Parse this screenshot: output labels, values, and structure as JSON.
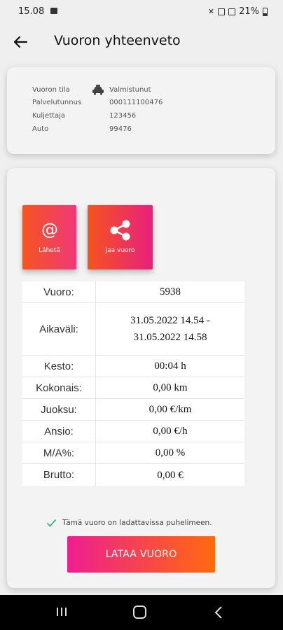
{
  "status_bar": {
    "time": "15.08",
    "battery_pct": "21%"
  },
  "app_bar": {
    "title": "Vuoron yhteenveto"
  },
  "summary": {
    "rows": [
      {
        "label": "Vuoron tila",
        "value": "Valmistunut"
      },
      {
        "label": "Palvelutunnus",
        "value": "000111100476"
      },
      {
        "label": "Kuljettaja",
        "value": "123456"
      },
      {
        "label": "Auto",
        "value": "99476"
      }
    ]
  },
  "actions": {
    "send_label": "Lähetä",
    "share_label": "Jaa vuoro"
  },
  "details": {
    "rows": [
      {
        "label": "Vuoro:",
        "value": "5938"
      },
      {
        "label": "Aikaväli:",
        "value": "31.05.2022 14.54 -",
        "value2": "31.05.2022 14.58"
      },
      {
        "label": "Kesto:",
        "value": "00:04 h"
      },
      {
        "label": "Kokonais:",
        "value": "0,00 km"
      },
      {
        "label": "Juoksu:",
        "value": "0,00 €/km"
      },
      {
        "label": "Ansio:",
        "value": "0,00 €/h"
      },
      {
        "label": "M/A%:",
        "value": "0,00 %"
      },
      {
        "label": "Brutto:",
        "value": "0,00 €"
      }
    ]
  },
  "download": {
    "note": "Tämä vuoro on ladattavissa puhelimeen.",
    "button_label": "LATAA VUORO"
  },
  "colors": {
    "accent_orange": "#ff6a0d",
    "accent_pink": "#ee1f8f",
    "check_green": "#3cb371"
  }
}
